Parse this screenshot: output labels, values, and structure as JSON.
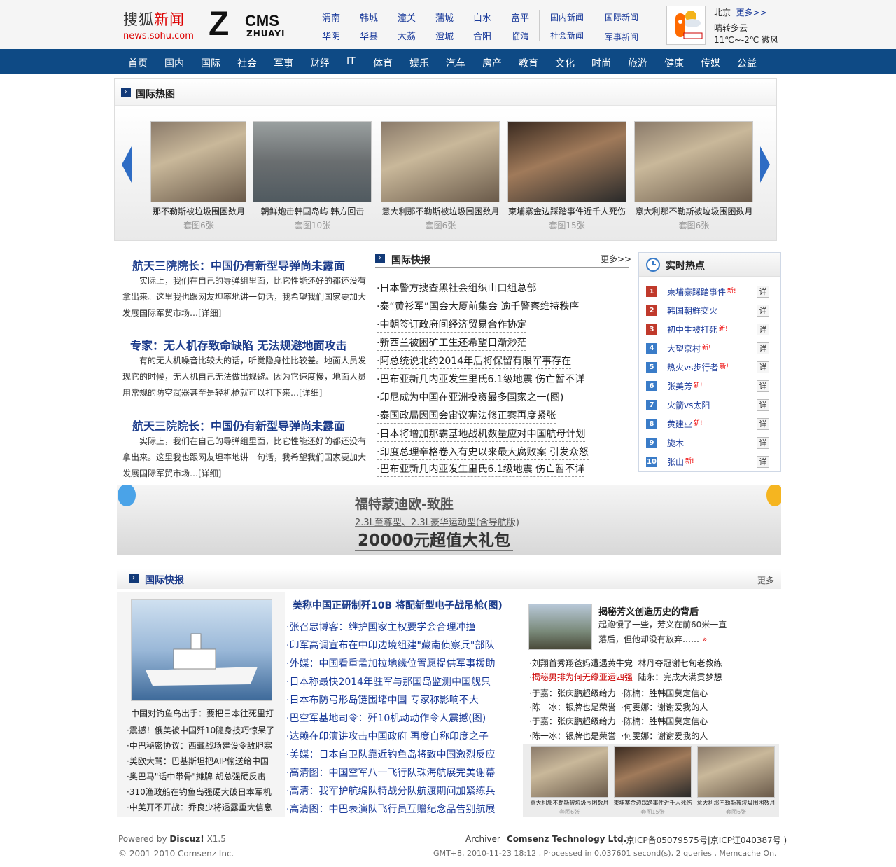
{
  "header": {
    "logo_text_black": "搜狐",
    "logo_text_red": "新闻",
    "logo_url": "news.sohu.com",
    "zcms_z": "Z",
    "zcms_cms": "CMS",
    "zcms_sub": "ZHUAYI",
    "cities": [
      "渭南",
      "韩城",
      "潼关",
      "蒲城",
      "白水",
      "富平",
      "华阴",
      "华县",
      "大荔",
      "澄城",
      "合阳",
      "临渭"
    ],
    "news_links": [
      "国内新闻",
      "国际新闻",
      "社会新闻",
      "军事新闻"
    ],
    "weather_city": "北京",
    "weather_more": "更多>>",
    "weather_desc": "晴转多云",
    "weather_temp": "11℃~-2℃ 微风"
  },
  "nav": [
    "首页",
    "国内",
    "国际",
    "社会",
    "军事",
    "财经",
    "IT",
    "体育",
    "娱乐",
    "汽车",
    "房产",
    "教育",
    "文化",
    "时尚",
    "旅游",
    "健康",
    "传媒",
    "公益"
  ],
  "hot_pics": {
    "title": "国际热图",
    "items": [
      {
        "caption": "那不勒斯被垃圾围困数月",
        "count": "套图6张"
      },
      {
        "caption": "朝鲜炮击韩国岛屿 韩方回击",
        "count": "套图10张"
      },
      {
        "caption": "意大利那不勒斯被垃圾围困数月",
        "count": "套图6张"
      },
      {
        "caption": "柬埔寨金边踩踏事件近千人死伤",
        "count": "套图15张"
      },
      {
        "caption": "意大利那不勒斯被垃圾围困数月",
        "count": "套图6张"
      }
    ]
  },
  "leads": [
    {
      "title": "航天三院院长：中国仍有新型导弹尚未露面",
      "body": "实际上，我们在自己的导弹组里面，比它性能还好的都还没有拿出来。这里我也跟网友坦率地讲一句话，我希望我们国家要加大发展国际军贸市场…[详细]"
    },
    {
      "title": "专家：无人机存致命缺陷 无法规避地面攻击",
      "body": "有的无人机噪音比较大的话，听觉隐身性比较差。地面人员发现它的时候，无人机自己无法做出规避。因为它速度慢，地面人员用常规的防空武器甚至是轻机枪就可以打下来…[详细]"
    },
    {
      "title": "航天三院院长：中国仍有新型导弹尚未露面",
      "body": "实际上，我们在自己的导弹组里面，比它性能还好的都还没有拿出来。这里我也跟网友坦率地讲一句话，我希望我们国家要加大发展国际军贸市场…[详细]"
    }
  ],
  "express": {
    "title": "国际快报",
    "more": "更多>>",
    "items": [
      "日本警方搜查黑社会组织山口组总部",
      "泰“黄衫军”国会大厦前集会 逾千警察维持秩序",
      "中朝签订政府间经济贸易合作协定",
      "新西兰被困矿工生还希望日渐渺茫",
      "阿总统说北约2014年后将保留有限军事存在",
      "巴布亚新几内亚发生里氏6.1级地震 伤亡暂不详",
      "印尼成为中国在亚洲投资最多国家之一(图)",
      "泰国政局因国会宙议宪法修正案再度紧张",
      "日本将增加那霸基地战机数量应对中国航母计划",
      "印度总理辛格卷入有史以来最大腐败案 引发众怒",
      "巴布亚新几内亚发生里氏6.1级地震 伤亡暂不详"
    ]
  },
  "hot_list": {
    "title": "实时热点",
    "new_label": "新!",
    "detail_label": "详",
    "items": [
      {
        "rank": "1",
        "name": "柬埔寨踩踏事件",
        "new": true
      },
      {
        "rank": "2",
        "name": "韩国朝鲜交火",
        "new": false
      },
      {
        "rank": "3",
        "name": "初中生被打死",
        "new": true
      },
      {
        "rank": "4",
        "name": "大望京村",
        "new": true
      },
      {
        "rank": "5",
        "name": "热火vs步行者",
        "new": true
      },
      {
        "rank": "6",
        "name": "张美芳",
        "new": true
      },
      {
        "rank": "7",
        "name": "火箭vs太阳",
        "new": false
      },
      {
        "rank": "8",
        "name": "黄建业",
        "new": true
      },
      {
        "rank": "9",
        "name": "旋木",
        "new": false
      },
      {
        "rank": "10",
        "name": "张山",
        "new": true
      }
    ],
    "colors": {
      "top": "#c0392b",
      "rest": "#3a7cc8"
    }
  },
  "banner": {
    "line1": "福特蒙迪欧-致胜",
    "line2": "2.3L至尊型、2.3L豪华运动型(含导航版)",
    "line3": "20000元超值大礼包"
  },
  "section2": {
    "title": "国际快报",
    "more": "更多",
    "photo_caption": "中国对钓鱼岛出手：要把日本往死里打",
    "left_list": [
      "震撼！俄美被中国歼10隐身技巧惊呆了",
      "中巴秘密协议：西藏战场建设令敌胆寒",
      "美欧大骂：巴基斯坦把AIP偷送给中国",
      "奥巴马\"话中带骨\"摊牌 胡总强硬反击",
      "310渔政船在钓鱼岛强硬大破日本军机",
      "中美开不开战：乔良少将透露重大信息"
    ],
    "main_title": "美称中国正研制歼10B 将配新型电子战吊舱(图)",
    "main_list": [
      "张召忠博客：维护国家主权要学会合理冲撞",
      "印军高调宣布在中印边境组建\"藏南侦察兵\"部队",
      "外媒：中国看重孟加拉地缘位置愿提供军事援助",
      "日本称最快2014年驻军与那国岛监测中国舰只",
      "日本布防弓形岛链围堵中国 专家称影响不大",
      "巴空军基地司令：歼10机动动作令人震撼(图)",
      "达赖在印演讲攻击中国政府 再度自称印度之子",
      "美媒：日本自卫队靠近钓鱼岛将致中国激烈反应",
      "高清图：中国空军八一飞行队珠海航展完美谢幕",
      "高清：我军护航编队特战分队航渡期间加紧练兵",
      "高清图：中巴表演队飞行员互赠纪念品告别航展"
    ],
    "feature_title": "揭秘芳义创造历史的背后",
    "feature_body": "起跑慢了一些，芳义在前60米一直落后，但他却没有放弃……",
    "feature_more": "»",
    "right_lines": [
      [
        "刘翔首秀翔爸妈遭遇黄牛党",
        "林丹夺冠谢七旬老教练"
      ],
      [
        "揭秘男排为何无缘亚运四强",
        "陆永：完成大满贯梦想"
      ],
      [
        "于嘉：张庆鹏超级给力",
        "陈楠：胜韩国莫定信心"
      ],
      [
        "陈一冰：银牌也是荣誉",
        "何雯娜：谢谢爱我的人"
      ],
      [
        "于嘉：张庆鹏超级给力",
        "陈楠：胜韩国莫定信心"
      ],
      [
        "陈一冰：银牌也是荣誉",
        "何雯娜：谢谢爱我的人"
      ]
    ],
    "thumbs": [
      {
        "caption": "意大利那不勒斯被垃圾围困数月",
        "count": "套图6张"
      },
      {
        "caption": "柬埔寨金边踩踏事件近千人死伤",
        "count": "套图15张"
      },
      {
        "caption": "意大利那不勒斯被垃圾围困数月",
        "count": "套图6张"
      }
    ]
  },
  "footer": {
    "powered_prefix": "Powered by",
    "powered_name": "Discuz!",
    "powered_ver": "X1.5",
    "copyright": "© 2001-2010 Comsenz Inc.",
    "archiver": "Archiver",
    "company": "Comsenz Technology Ltd.",
    "icp": "( 京ICP备05079575号|京ICP证040387号 )",
    "stats": "GMT+8, 2010-11-23 18:12 , Processed in 0.037601 second(s), 2 queries , Memcache On."
  }
}
